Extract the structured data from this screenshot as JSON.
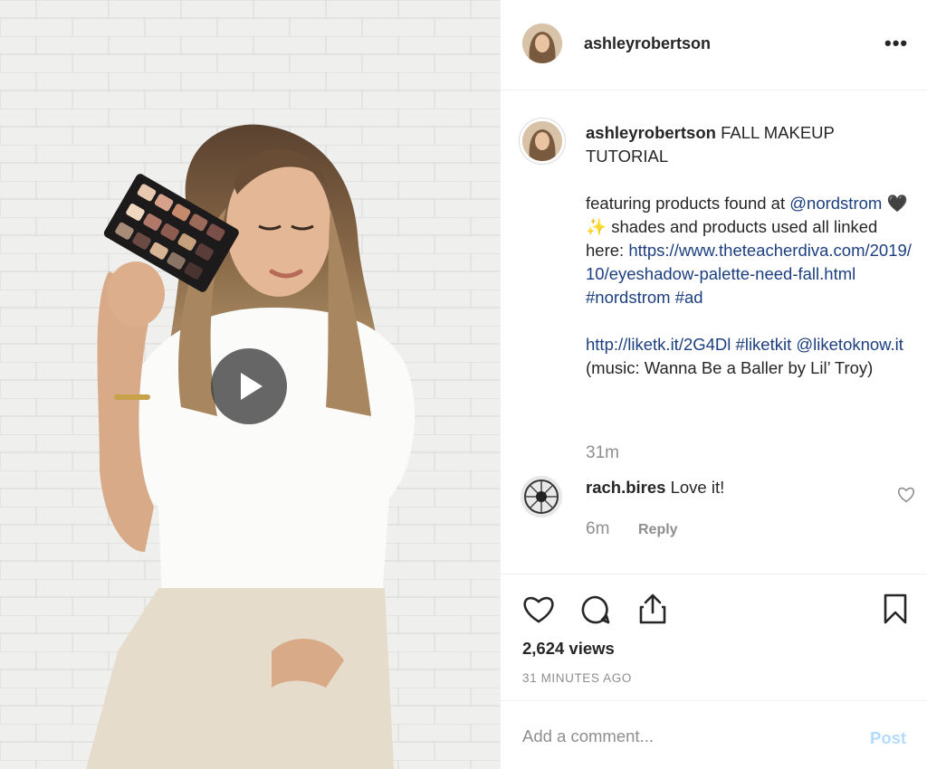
{
  "post": {
    "username": "ashleyrobertson",
    "more_icon": "more-horizontal-icon",
    "more_label": "•••"
  },
  "caption": {
    "username": "ashleyrobertson",
    "title": " FALL MAKEUP TUTORIAL",
    "line_a": "featuring products found at",
    "mention_1": "@nordstrom",
    "emoji": " 🖤 ✨ ",
    "line_b": "shades and products used all linked here:",
    "link_1": "https://www.theteacherdiva.com/2019/10/eyeshadow-palette-need-fall.html",
    "hashtag_1": "#nordstrom",
    "hashtag_2": "#ad",
    "link_2": "http://liketk.it/2G4Dl",
    "hashtag_3": "#liketkit",
    "mention_2": "@liketoknow.it",
    "line_c": " (music: Wanna Be a Baller by Lil’ Troy)",
    "time": "31m"
  },
  "comment": {
    "username": "rach.bires",
    "text": " Love it!",
    "time": "6m",
    "reply_label": "Reply"
  },
  "actions": {
    "like_icon": "heart-icon",
    "comment_icon": "comment-icon",
    "share_icon": "share-icon",
    "save_icon": "bookmark-icon",
    "views": "2,624 views",
    "posted": "31 MINUTES AGO"
  },
  "add_comment": {
    "placeholder": "Add a comment...",
    "post_label": "Post"
  },
  "media": {
    "play_icon": "play-icon"
  },
  "colors": {
    "link": "#1c3f80",
    "muted": "#8e8e8e",
    "post_disabled": "#b3dbff"
  }
}
